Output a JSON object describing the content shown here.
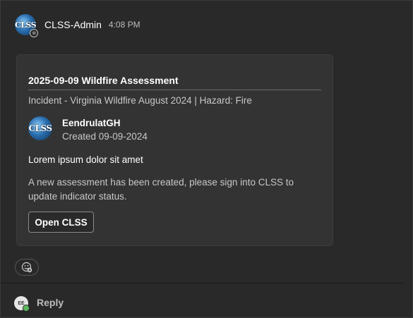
{
  "message": {
    "avatar_text": "CLSS",
    "sender": "CLSS-Admin",
    "time": "4:08 PM"
  },
  "card": {
    "title": "2025-09-09 Wildfire Assessment",
    "subtitle": "Incident - Virginia Wildfire August 2024 | Hazard: Fire",
    "author": {
      "avatar_text": "CLSS",
      "name": "EendrulatGH",
      "created": "Created 09-09-2024"
    },
    "heading": "Lorem ipsum dolor sit amet",
    "body": "A new assessment has been created, please sign into CLSS to update indicator status.",
    "button_label": "Open CLSS"
  },
  "reply": {
    "avatar_initials": "EE",
    "label": "Reply"
  },
  "colors": {
    "background": "#292929",
    "card": "#333333",
    "presence": "#5cb85c"
  },
  "icons": {
    "reaction": "add-reaction-icon",
    "status": "status-badge-icon"
  }
}
